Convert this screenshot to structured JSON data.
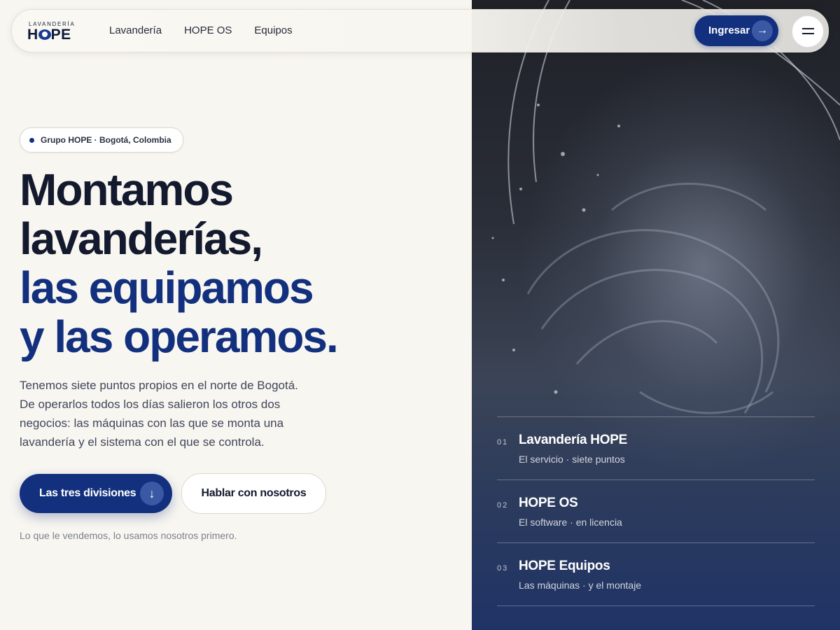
{
  "nav": {
    "logo_small": "LAVANDERÍA",
    "logo_big": "HOPE",
    "links": [
      "Lavandería",
      "HOPE OS",
      "Equipos"
    ],
    "login_label": "Ingresar",
    "login_icon": "arrow-right-icon",
    "menu_icon": "hamburger-menu-icon"
  },
  "hero": {
    "location": "Grupo HOPE · Bogotá, Colombia",
    "headline": {
      "line1": "Montamos",
      "line2": "lavanderías,",
      "line3": "las equipamos",
      "line4": "y las operamos."
    },
    "intro": "Tenemos siete puntos propios en el norte de Bogotá. De operarlos todos los días salieron los otros dos negocios: las máquinas con las que se monta una lavandería y el sistema con el que se controla.",
    "primary_button": "Las tres divisiones",
    "primary_icon": "arrow-down-icon",
    "secondary_button": "Hablar con nosotros",
    "tagline": "Lo que le vendemos, lo usamos nosotros primero."
  },
  "divisions": [
    {
      "number": "01",
      "title": "Lavandería HOPE",
      "subtitle": "El servicio · siete puntos"
    },
    {
      "number": "02",
      "title": "HOPE OS",
      "subtitle": "El software · en licencia"
    },
    {
      "number": "03",
      "title": "HOPE Equipos",
      "subtitle": "Las máquinas · y el montaje"
    }
  ],
  "colors": {
    "accent": "#12307e",
    "background": "#f8f6f1",
    "text": "#141a2e"
  }
}
